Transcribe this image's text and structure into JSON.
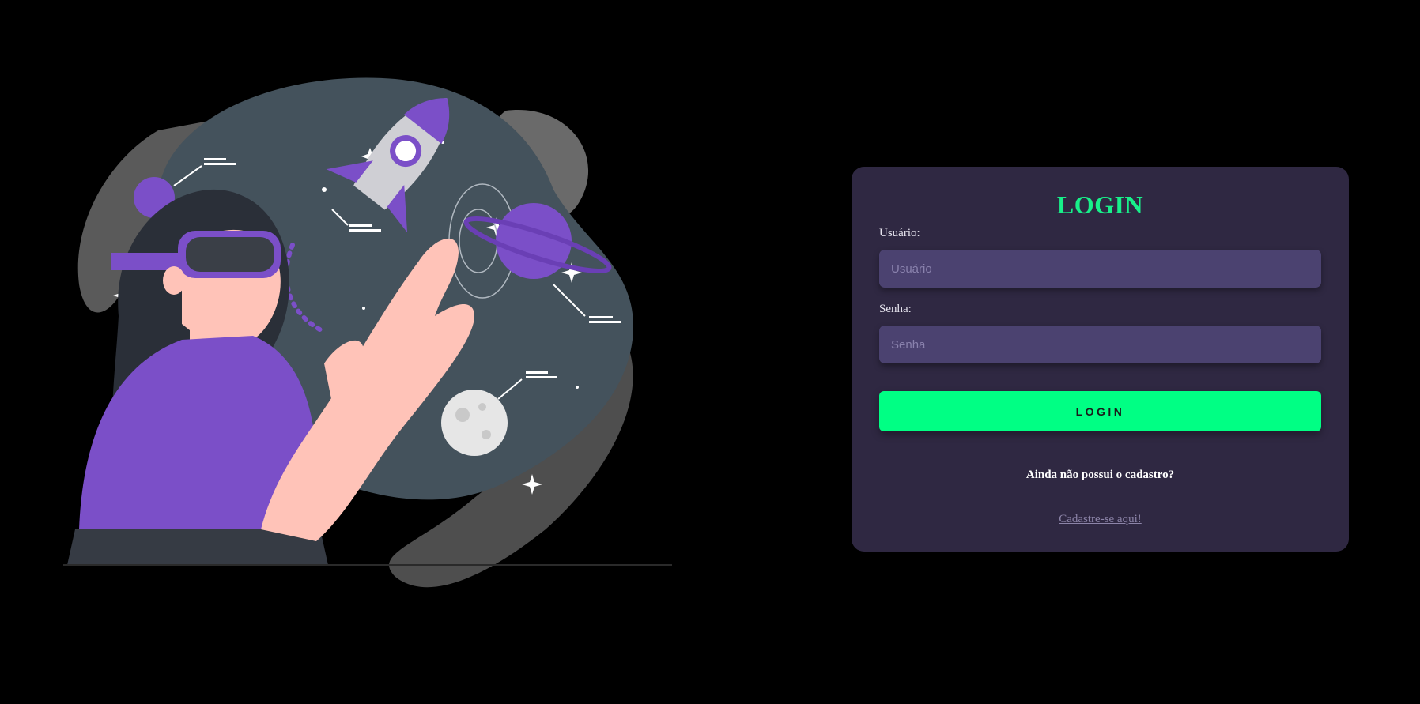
{
  "login_card": {
    "title": "LOGIN",
    "user_label": "Usuário:",
    "user_placeholder": "Usuário",
    "user_value": "",
    "password_label": "Senha:",
    "password_placeholder": "Senha",
    "password_value": "",
    "submit_label": "LOGIN",
    "signup_question": "Ainda não possui o cadastro?",
    "signup_link": "Cadastre-se aqui!"
  },
  "illustration": {
    "icon": "vr-girl-space-illustration"
  },
  "colors": {
    "background": "#000000",
    "card_background": "#2f2842",
    "title": "#18f08a",
    "button": "#00ff84",
    "input_background": "#4b4270",
    "link": "#8c84a8",
    "accent_purple": "#7b4fc8"
  }
}
